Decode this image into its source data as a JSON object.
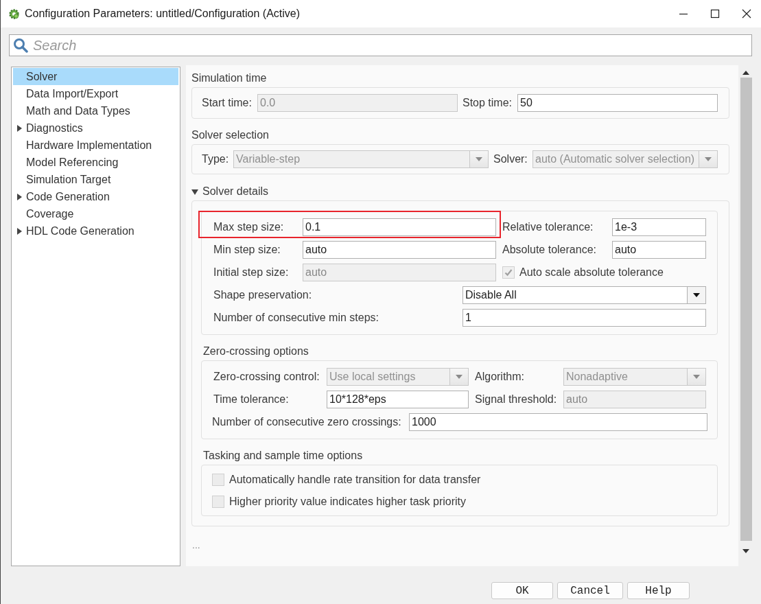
{
  "window": {
    "title": "Configuration Parameters: untitled/Configuration (Active)"
  },
  "search": {
    "placeholder": "Search"
  },
  "sidebar": {
    "items": [
      {
        "label": "Solver",
        "kind": "leaf",
        "selected": true
      },
      {
        "label": "Data Import/Export",
        "kind": "leaf",
        "selected": false
      },
      {
        "label": "Math and Data Types",
        "kind": "leaf",
        "selected": false
      },
      {
        "label": "Diagnostics",
        "kind": "group",
        "expanded": false,
        "selected": false
      },
      {
        "label": "Hardware Implementation",
        "kind": "leaf",
        "selected": false
      },
      {
        "label": "Model Referencing",
        "kind": "leaf",
        "selected": false
      },
      {
        "label": "Simulation Target",
        "kind": "leaf",
        "selected": false
      },
      {
        "label": "Code Generation",
        "kind": "group",
        "expanded": false,
        "selected": false
      },
      {
        "label": "Coverage",
        "kind": "leaf",
        "selected": false
      },
      {
        "label": "HDL Code Generation",
        "kind": "group",
        "expanded": false,
        "selected": false
      }
    ]
  },
  "simulation_time": {
    "title": "Simulation time",
    "fields": [
      {
        "label": "Start time:",
        "value": "0.0",
        "disabled": true
      },
      {
        "label": "Stop time:",
        "value": "50",
        "disabled": false
      }
    ]
  },
  "solver_selection": {
    "title": "Solver selection",
    "dropdowns": [
      {
        "label": "Type:",
        "value": "Variable-step",
        "disabled": true
      },
      {
        "label": "Solver:",
        "value": "auto (Automatic solver selection)",
        "disabled": true
      }
    ]
  },
  "solver_details": {
    "title": "Solver details",
    "expanded": true,
    "fields": [
      {
        "label": "Max step size:",
        "value": "0.1",
        "disabled": false,
        "highlighted": true
      },
      {
        "label": "Relative tolerance:",
        "value": "1e-3",
        "disabled": false,
        "highlighted": false
      },
      {
        "label": "Min step size:",
        "value": "auto",
        "disabled": false,
        "highlighted": false
      },
      {
        "label": "Absolute tolerance:",
        "value": "auto",
        "disabled": false,
        "highlighted": false
      },
      {
        "label": "Initial step size:",
        "value": "auto",
        "disabled": true,
        "highlighted": false
      }
    ],
    "auto_scale": {
      "label": "Auto scale absolute tolerance",
      "checked": true,
      "disabled": true
    },
    "shape_preservation": {
      "label": "Shape preservation:",
      "value": "Disable All",
      "disabled": false
    },
    "min_steps": {
      "label": "Number of consecutive min steps:",
      "value": "1",
      "disabled": false
    }
  },
  "zero_crossing": {
    "title": "Zero-crossing options",
    "control": {
      "label": "Zero-crossing control:",
      "value": "Use local settings",
      "disabled": true
    },
    "algorithm": {
      "label": "Algorithm:",
      "value": "Nonadaptive",
      "disabled": true
    },
    "time_tolerance": {
      "label": "Time tolerance:",
      "value": "10*128*eps",
      "disabled": false
    },
    "signal_threshold": {
      "label": "Signal threshold:",
      "value": "auto",
      "disabled": true
    },
    "consecutive": {
      "label": "Number of consecutive zero crossings:",
      "value": "1000",
      "disabled": false
    }
  },
  "tasking": {
    "title": "Tasking and sample time options",
    "checkboxes": [
      {
        "label": "Automatically handle rate transition for data transfer",
        "checked": false
      },
      {
        "label": "Higher priority value indicates higher task priority",
        "checked": false
      }
    ]
  },
  "more": "...",
  "buttons": [
    {
      "label": "OK"
    },
    {
      "label": "Cancel"
    },
    {
      "label": "Help"
    }
  ]
}
